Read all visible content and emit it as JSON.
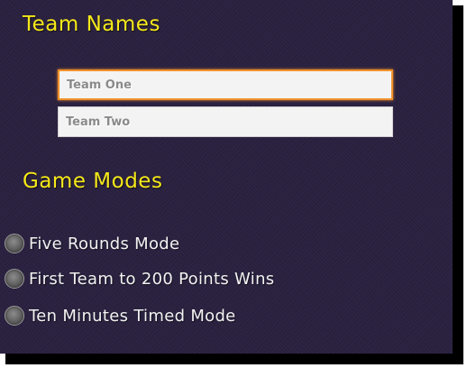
{
  "team_section": {
    "title": "Team Names",
    "team_one_placeholder": "Team One",
    "team_two_placeholder": "Team Two",
    "team_one_value": "",
    "team_two_value": ""
  },
  "modes_section": {
    "title": "Game Modes",
    "options": [
      {
        "label": "Five Rounds Mode",
        "selected": false
      },
      {
        "label": "First Team to 200 Points Wins",
        "selected": false
      },
      {
        "label": "Ten Minutes Timed Mode",
        "selected": false
      }
    ]
  },
  "colors": {
    "background": "#2a2140",
    "heading": "#f5e81a",
    "focus_border": "#f0902a",
    "option_text": "#f2f2f2"
  }
}
